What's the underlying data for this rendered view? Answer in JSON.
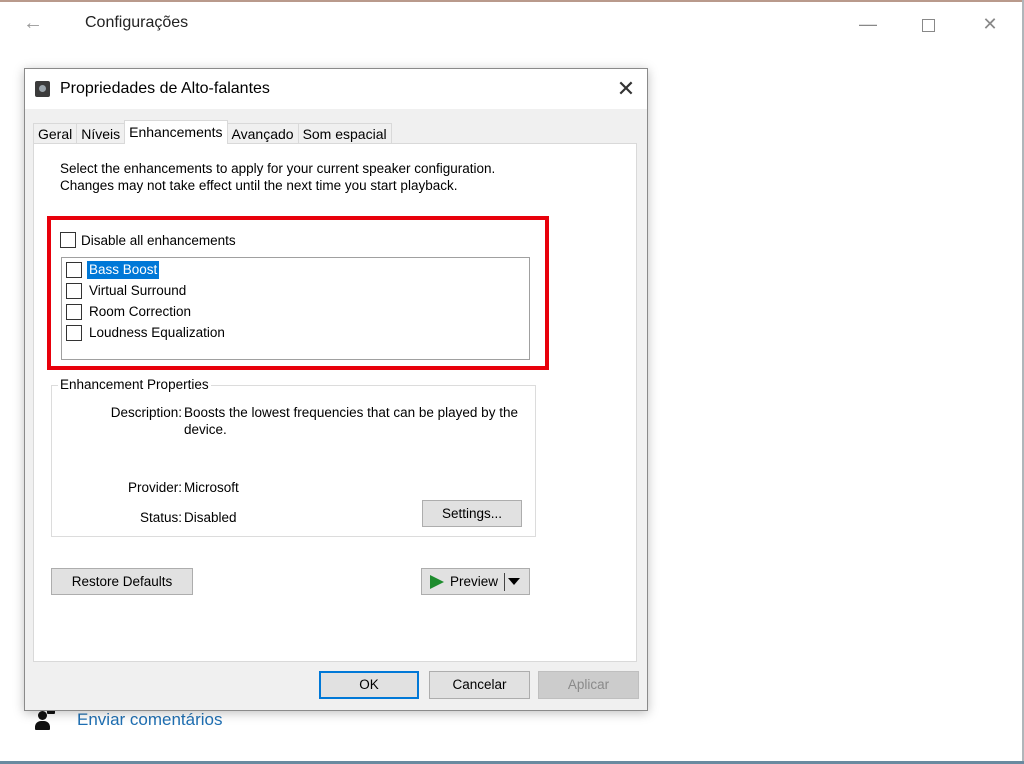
{
  "settings_window": {
    "title": "Configurações",
    "back_icon": "arrow-left-icon",
    "controls": {
      "minimize": "—",
      "maximize": "",
      "close": "✕"
    },
    "feedback_link": "Enviar comentários",
    "feedback_icon": "feedback-person-icon"
  },
  "dialog": {
    "title": "Propriedades de Alto-falantes",
    "close_glyph": "✕",
    "tabs": [
      {
        "label": "Geral",
        "active": false
      },
      {
        "label": "Níveis",
        "active": false
      },
      {
        "label": "Enhancements",
        "active": true
      },
      {
        "label": "Avançado",
        "active": false
      },
      {
        "label": "Som espacial",
        "active": false
      }
    ],
    "intro_text": "Select the enhancements to apply for your current speaker configuration. Changes may not take effect until the next time you start playback.",
    "disable_all": {
      "label": "Disable all enhancements",
      "checked": false
    },
    "enhancements": [
      {
        "label": "Bass Boost",
        "checked": false,
        "selected": true
      },
      {
        "label": "Virtual Surround",
        "checked": false,
        "selected": false
      },
      {
        "label": "Room Correction",
        "checked": false,
        "selected": false
      },
      {
        "label": "Loudness Equalization",
        "checked": false,
        "selected": false
      }
    ],
    "highlight_color": "#e8000b",
    "properties": {
      "legend": "Enhancement Properties",
      "description_label": "Description:",
      "description_value": "Boosts the lowest frequencies that can be played by the device.",
      "provider_label": "Provider:",
      "provider_value": "Microsoft",
      "status_label": "Status:",
      "status_value": "Disabled",
      "settings_button": "Settings..."
    },
    "restore_defaults_button": "Restore Defaults",
    "preview_button": "Preview",
    "buttons": {
      "ok": "OK",
      "cancel": "Cancelar",
      "apply": "Aplicar",
      "apply_enabled": false
    }
  }
}
